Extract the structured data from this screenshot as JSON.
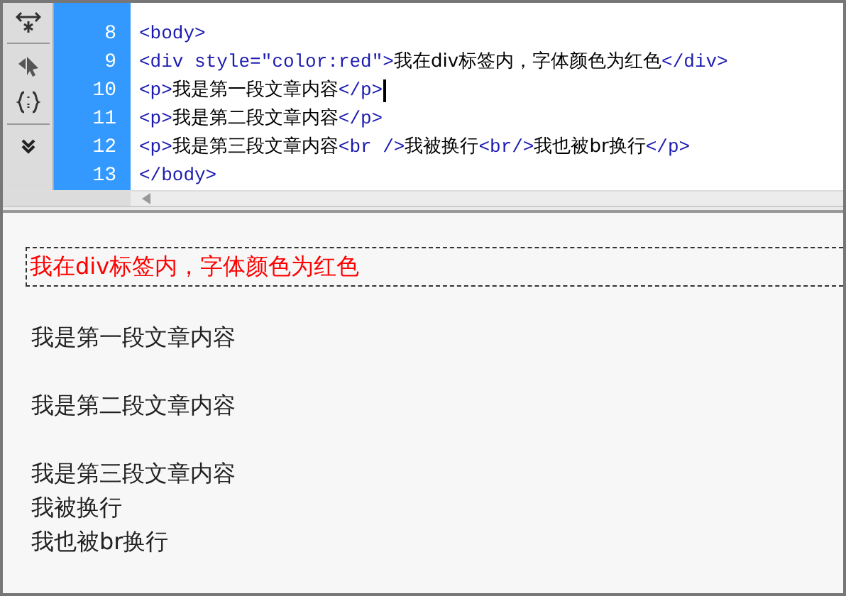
{
  "code_view": {
    "lines": [
      {
        "number": "8",
        "segments": [
          {
            "kind": "tag",
            "text": "<body>"
          }
        ],
        "cursor": false
      },
      {
        "number": "9",
        "segments": [
          {
            "kind": "tag",
            "text": "<div "
          },
          {
            "kind": "attr",
            "text": "style"
          },
          {
            "kind": "plain",
            "text": "="
          },
          {
            "kind": "value",
            "text": "\"color:red\""
          },
          {
            "kind": "tag",
            "text": ">"
          },
          {
            "kind": "text",
            "text": "我在div标签内，字体颜色为红色"
          },
          {
            "kind": "tag",
            "text": "</div>"
          }
        ],
        "cursor": false
      },
      {
        "number": "10",
        "segments": [
          {
            "kind": "tag",
            "text": "<p>"
          },
          {
            "kind": "text",
            "text": "我是第一段文章内容"
          },
          {
            "kind": "tag",
            "text": "</p>"
          }
        ],
        "cursor": true
      },
      {
        "number": "11",
        "segments": [
          {
            "kind": "tag",
            "text": "<p>"
          },
          {
            "kind": "text",
            "text": "我是第二段文章内容"
          },
          {
            "kind": "tag",
            "text": "</p>"
          }
        ],
        "cursor": false
      },
      {
        "number": "12",
        "segments": [
          {
            "kind": "tag",
            "text": "<p>"
          },
          {
            "kind": "text",
            "text": "我是第三段文章内容"
          },
          {
            "kind": "tag",
            "text": "<br />"
          },
          {
            "kind": "text",
            "text": "我被换行"
          },
          {
            "kind": "tag",
            "text": "<br/>"
          },
          {
            "kind": "text",
            "text": "我也被br换行"
          },
          {
            "kind": "tag",
            "text": "</p>"
          }
        ],
        "cursor": false
      },
      {
        "number": "13",
        "segments": [
          {
            "kind": "tag",
            "text": "</body>"
          }
        ],
        "cursor": false
      }
    ]
  },
  "design_view": {
    "blocks": [
      {
        "kind": "div",
        "color": "#ff0000",
        "lines": [
          "我在div标签内，字体颜色为红色"
        ]
      },
      {
        "kind": "p",
        "lines": [
          "我是第一段文章内容"
        ]
      },
      {
        "kind": "p",
        "lines": [
          "我是第二段文章内容"
        ]
      },
      {
        "kind": "p",
        "lines": [
          "我是第三段文章内容",
          "我被换行",
          "我也被br换行"
        ]
      }
    ]
  }
}
